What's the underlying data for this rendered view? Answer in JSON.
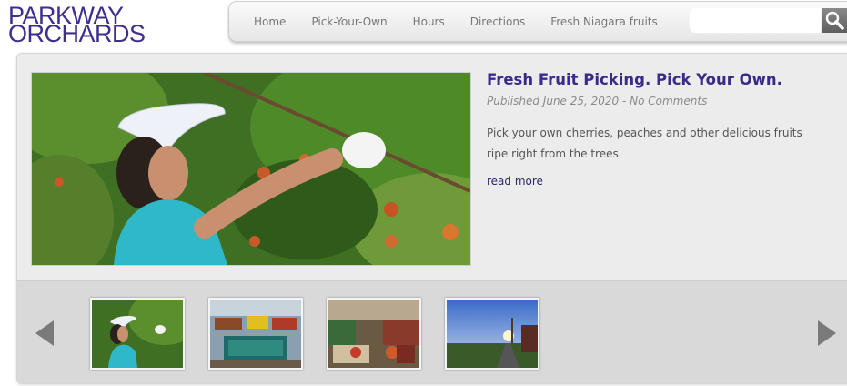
{
  "logo": {
    "line1": "PARKWAY",
    "line2": "ORCHARDS"
  },
  "nav": {
    "items": [
      "Home",
      "Pick-Your-Own",
      "Hours",
      "Directions",
      "Fresh Niagara fruits"
    ]
  },
  "search": {
    "placeholder": "",
    "value": ""
  },
  "icons": {
    "search": "search-icon",
    "prev": "arrow-left-icon",
    "next": "arrow-right-icon"
  },
  "colors": {
    "brand": "#3d2f8f",
    "title": "#3a2a8a",
    "link": "#2a2a6a"
  },
  "post": {
    "title": "Fresh Fruit Picking. Pick Your Own.",
    "meta": "Published June 25, 2020 - No Comments",
    "excerpt": "Pick your own cherries, peaches and other delicious fruits ripe right from the trees.",
    "read_more": "read more"
  }
}
